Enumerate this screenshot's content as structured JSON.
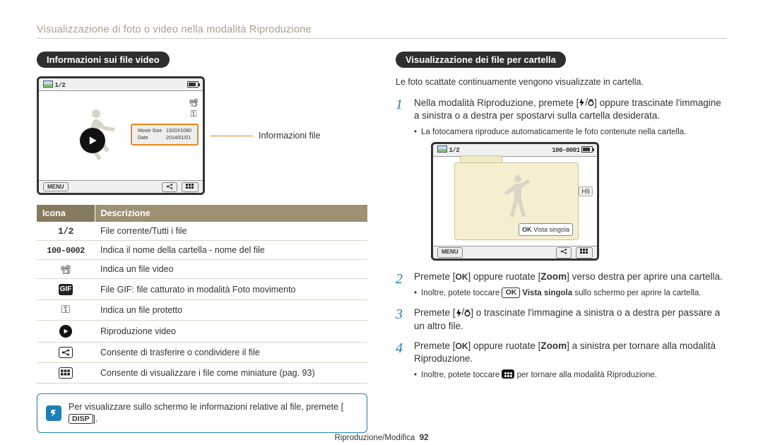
{
  "page_title": "Visualizzazione di foto o video nella modalità Riproduzione",
  "left": {
    "heading": "Informazioni sui file video",
    "thumb": {
      "counter": "1/2",
      "menu_label": "MENU",
      "info_callout": "Informazioni file",
      "info_rows": {
        "movie_size_label": "Movie Size",
        "movie_size_value": "1920X1080",
        "date_label": "Date",
        "date_value": "2014/01/01"
      }
    },
    "table": {
      "col_icona": "Icona",
      "col_descrizione": "Descrizione",
      "rows": [
        {
          "icon_text": "1/2",
          "icon_name": "counter",
          "desc": "File corrente/Tutti i file"
        },
        {
          "icon_text": "100-0002",
          "icon_name": "folder-file-number",
          "desc": "Indica il nome della cartella - nome del file"
        },
        {
          "icon_text": "",
          "icon_name": "movie-camera-icon",
          "desc": "Indica un file video"
        },
        {
          "icon_text": "GIF",
          "icon_name": "gif-icon",
          "desc": "File GIF: file catturato in modalità Foto movimento"
        },
        {
          "icon_text": "",
          "icon_name": "lock-key-icon",
          "desc": "Indica un file protetto"
        },
        {
          "icon_text": "",
          "icon_name": "play-icon",
          "desc": "Riproduzione video"
        },
        {
          "icon_text": "",
          "icon_name": "share-icon",
          "desc": "Consente di trasferire o condividere il file"
        },
        {
          "icon_text": "",
          "icon_name": "thumbnails-icon",
          "desc": "Consente di visualizzare i file come miniature (pag. 93)"
        }
      ]
    },
    "note_text_pre": "Per visualizzare sullo schermo le informazioni relative al file, premete [",
    "note_button": "DISP",
    "note_text_post": "]."
  },
  "right": {
    "heading": "Visualizzazione dei file per cartella",
    "intro": "Le foto scattate continuamente vengono visualizzate in cartella.",
    "steps": [
      {
        "text_pre": "Nella modalità Riproduzione, premete [",
        "text_post": "] oppure trascinate l'immagine a sinistra o a destra per spostarvi sulla cartella desiderata.",
        "sub": [
          "La fotocamera riproduce automaticamente le foto contenute nella cartella."
        ]
      },
      {
        "raw": "Premete [<ok>] oppure ruotate [<b>Zoom</b>] verso destra per aprire una cartella.",
        "sub": [
          "Inoltre, potete toccare <okbox> <b>Vista singola</b> sullo schermo per aprire la cartella."
        ]
      },
      {
        "text_pre": "Premete [",
        "text_post": "] o trascinate l'immagine a sinistra o a destra per passare a un altro file."
      },
      {
        "raw": "Premete [<ok>] oppure ruotate [<b>Zoom</b>] a sinistra per tornare alla modalità Riproduzione.",
        "sub": [
          "Inoltre, potete toccare <thumbicon> per tornare alla modalità Riproduzione."
        ]
      }
    ],
    "folder_thumb": {
      "counter": "1/2",
      "file_number": "100-0001",
      "h_count": "H5",
      "single_view_prefix": "OK",
      "single_view_label": "Vista singola",
      "menu_label": "MENU"
    }
  },
  "footer": {
    "section": "Riproduzione/Modifica",
    "page": "92"
  }
}
